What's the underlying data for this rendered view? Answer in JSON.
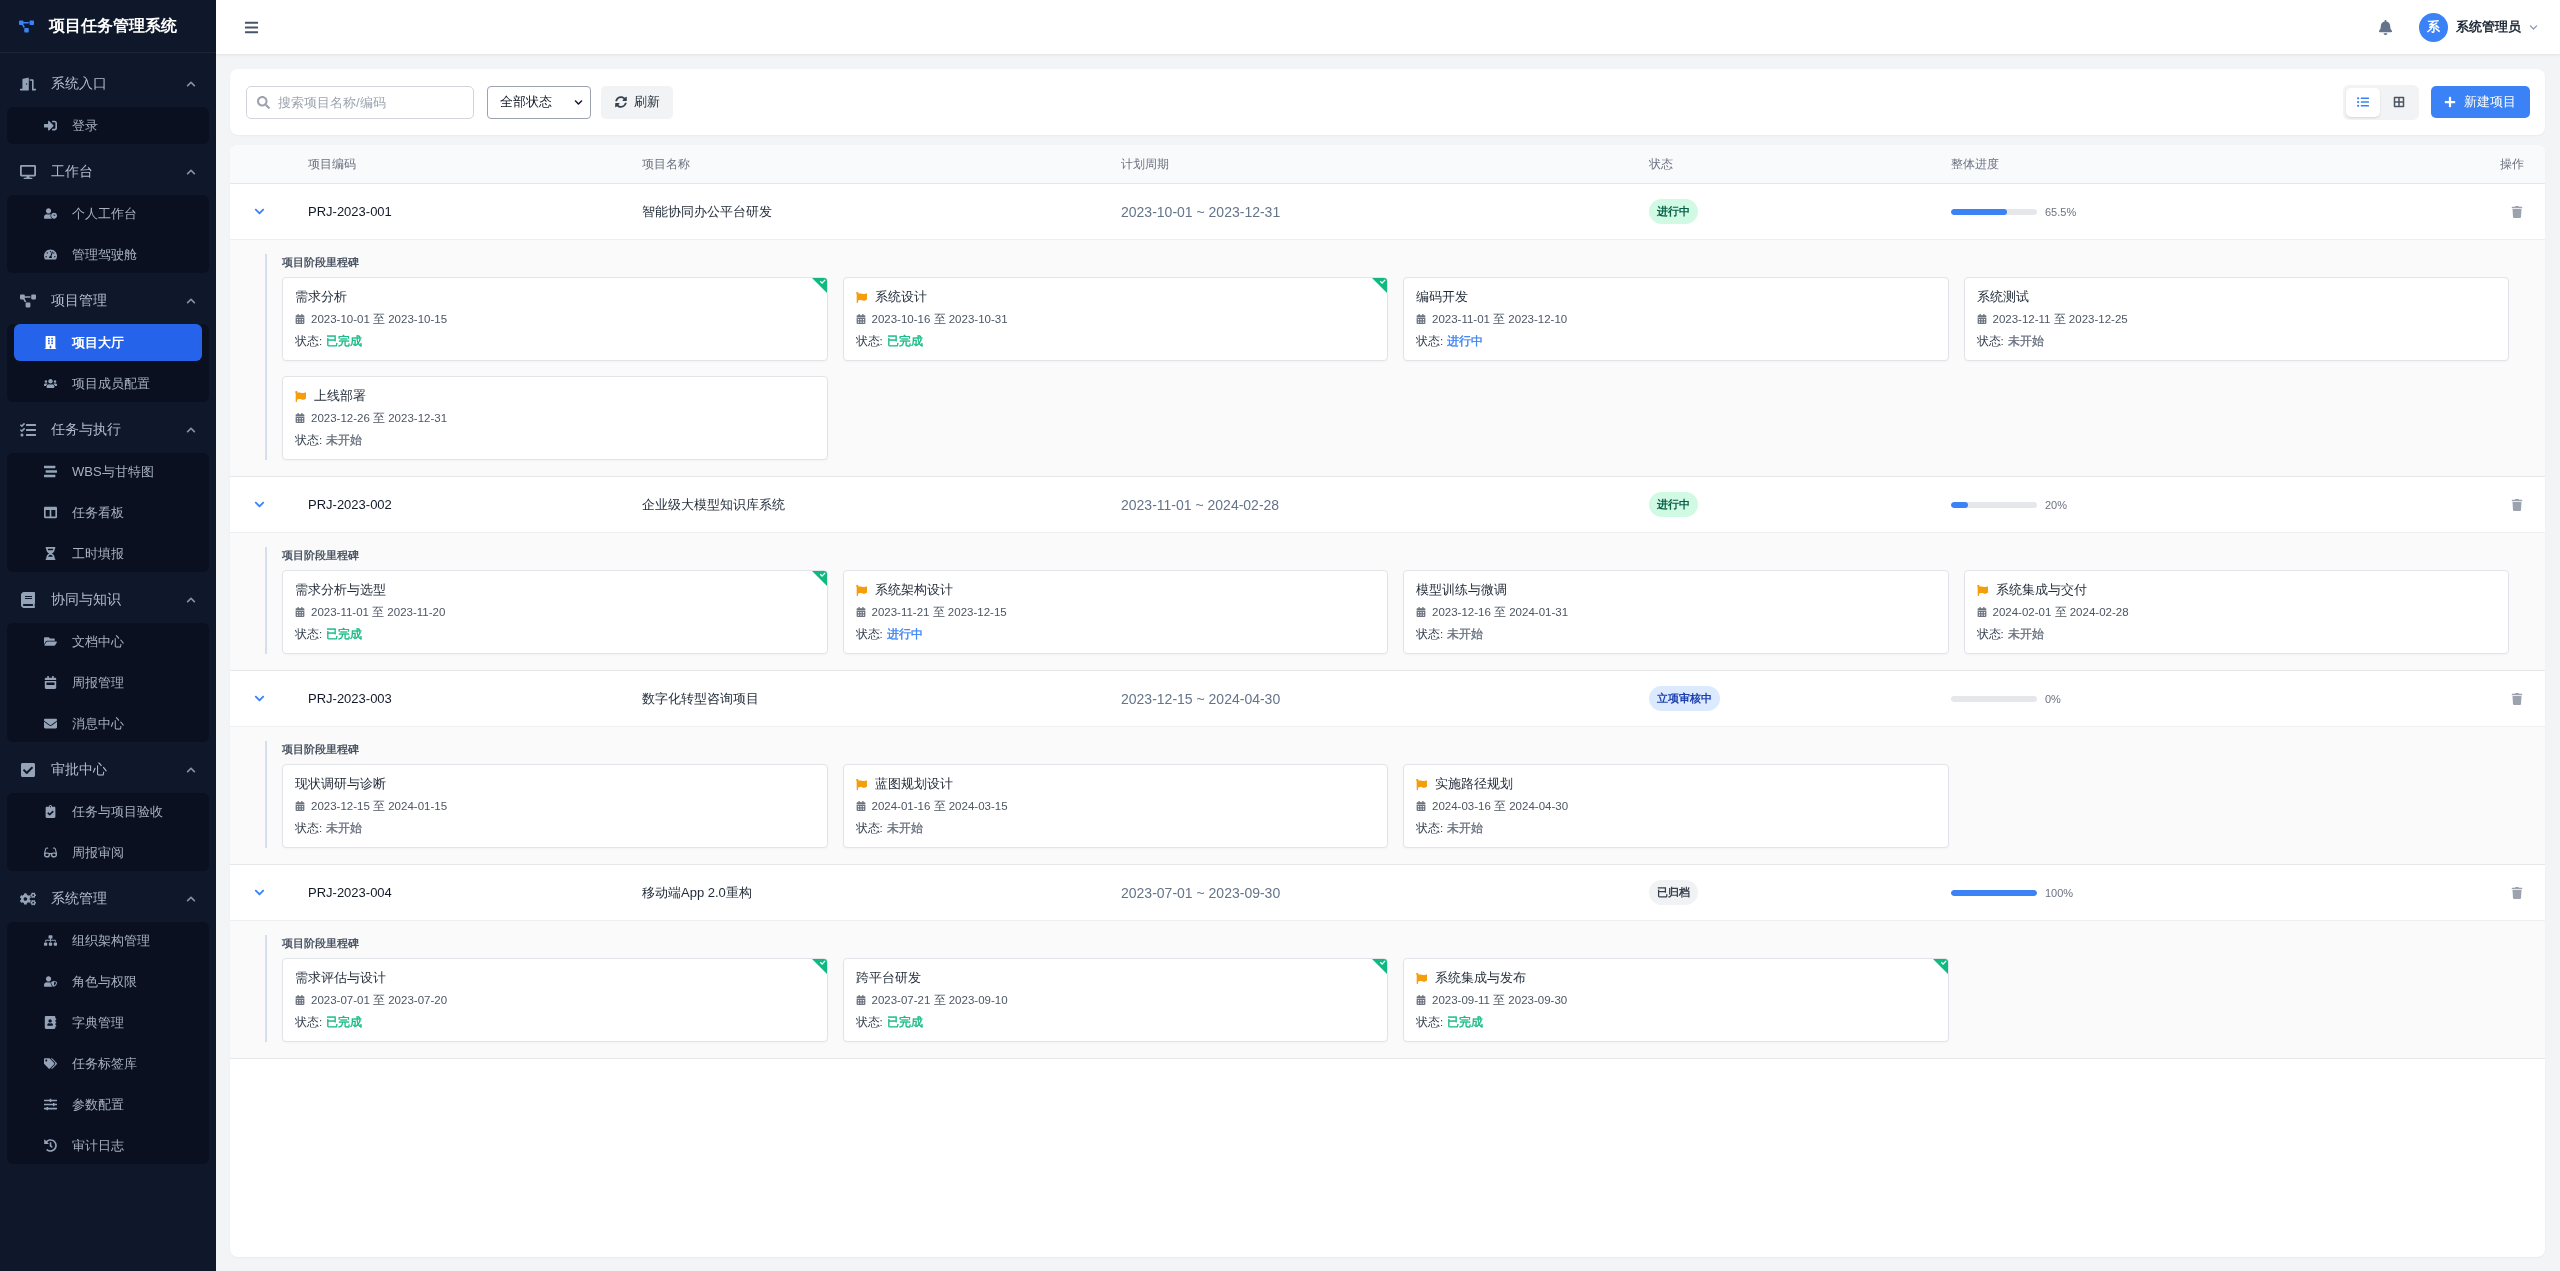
{
  "sidebar": {
    "title": "项目任务管理系统",
    "sections": [
      {
        "label": "系统入口",
        "expanded": true,
        "items": [
          {
            "label": "登录",
            "selected": false
          }
        ]
      },
      {
        "label": "工作台",
        "expanded": true,
        "items": [
          {
            "label": "个人工作台",
            "selected": false
          },
          {
            "label": "管理驾驶舱",
            "selected": false
          }
        ]
      },
      {
        "label": "项目管理",
        "expanded": true,
        "items": [
          {
            "label": "项目大厅",
            "selected": true
          },
          {
            "label": "项目成员配置",
            "selected": false
          }
        ]
      },
      {
        "label": "任务与执行",
        "expanded": true,
        "items": [
          {
            "label": "WBS与甘特图",
            "selected": false
          },
          {
            "label": "任务看板",
            "selected": false
          },
          {
            "label": "工时填报",
            "selected": false
          }
        ]
      },
      {
        "label": "协同与知识",
        "expanded": true,
        "items": [
          {
            "label": "文档中心",
            "selected": false
          },
          {
            "label": "周报管理",
            "selected": false
          },
          {
            "label": "消息中心",
            "selected": false
          }
        ]
      },
      {
        "label": "审批中心",
        "expanded": true,
        "items": [
          {
            "label": "任务与项目验收",
            "selected": false
          },
          {
            "label": "周报审阅",
            "selected": false
          }
        ]
      },
      {
        "label": "系统管理",
        "expanded": true,
        "items": [
          {
            "label": "组织架构管理",
            "selected": false
          },
          {
            "label": "角色与权限",
            "selected": false
          },
          {
            "label": "字典管理",
            "selected": false
          },
          {
            "label": "任务标签库",
            "selected": false
          },
          {
            "label": "参数配置",
            "selected": false
          },
          {
            "label": "审计日志",
            "selected": false
          }
        ]
      }
    ]
  },
  "header": {
    "user": {
      "avatar": "系",
      "name": "系统管理员"
    }
  },
  "toolbar": {
    "search": {
      "placeholder": "搜索项目名称/编码"
    },
    "status_filter": {
      "value": "全部状态"
    },
    "refresh_button": "刷新",
    "view_toggle": [
      {
        "selected": true
      },
      {
        "selected": false
      }
    ],
    "new_button": "新建项目"
  },
  "table": {
    "columns": [
      "项目编码",
      "项目名称",
      "计划周期",
      "状态",
      "整体进度",
      "操作"
    ],
    "projects": [
      {
        "code": "PRJ-2023-001",
        "name": "智能协同办公平台研发",
        "period": "2023-10-01 ~ 2023-12-31",
        "status": "进行中",
        "color": "#d1fae5",
        "level": 0.655,
        "progress": "65.5%",
        "expanded": true,
        "milestones_title": "项目阶段里程碑",
        "milestones": [
          {
            "title": "需求分析",
            "flag": false,
            "dates": "2023-10-01 至 2023-10-15",
            "status_label": "状态:",
            "status": "已完成",
            "color": "#10b981",
            "completed": true
          },
          {
            "title": "系统设计",
            "flag": true,
            "dates": "2023-10-16 至 2023-10-31",
            "status_label": "状态:",
            "status": "已完成",
            "color": "#10b981",
            "completed": true
          },
          {
            "title": "编码开发",
            "flag": false,
            "dates": "2023-11-01 至 2023-12-10",
            "status_label": "状态:",
            "status": "进行中",
            "color": "#3b82f6",
            "completed": false
          },
          {
            "title": "系统测试",
            "flag": false,
            "dates": "2023-12-11 至 2023-12-25",
            "status_label": "状态:",
            "status": "未开始",
            "color": "#6b7280",
            "completed": false
          },
          {
            "title": "上线部署",
            "flag": true,
            "dates": "2023-12-26 至 2023-12-31",
            "status_label": "状态:",
            "status": "未开始",
            "color": "#6b7280",
            "completed": false
          }
        ]
      },
      {
        "code": "PRJ-2023-002",
        "name": "企业级大模型知识库系统",
        "period": "2023-11-01 ~ 2024-02-28",
        "status": "进行中",
        "color": "#d1fae5",
        "level": 0.2,
        "progress": "20%",
        "expanded": true,
        "milestones_title": "项目阶段里程碑",
        "milestones": [
          {
            "title": "需求分析与选型",
            "flag": false,
            "dates": "2023-11-01 至 2023-11-20",
            "status_label": "状态:",
            "status": "已完成",
            "color": "#10b981",
            "completed": true
          },
          {
            "title": "系统架构设计",
            "flag": true,
            "dates": "2023-11-21 至 2023-12-15",
            "status_label": "状态:",
            "status": "进行中",
            "color": "#3b82f6",
            "completed": false
          },
          {
            "title": "模型训练与微调",
            "flag": false,
            "dates": "2023-12-16 至 2024-01-31",
            "status_label": "状态:",
            "status": "未开始",
            "color": "#6b7280",
            "completed": false
          },
          {
            "title": "系统集成与交付",
            "flag": true,
            "dates": "2024-02-01 至 2024-02-28",
            "status_label": "状态:",
            "status": "未开始",
            "color": "#6b7280",
            "completed": false
          }
        ]
      },
      {
        "code": "PRJ-2023-003",
        "name": "数字化转型咨询项目",
        "period": "2023-12-15 ~ 2024-04-30",
        "status": "立项审核中",
        "color": "#dbeafe",
        "level": 0,
        "progress": "0%",
        "expanded": true,
        "milestones_title": "项目阶段里程碑",
        "milestones": [
          {
            "title": "现状调研与诊断",
            "flag": false,
            "dates": "2023-12-15 至 2024-01-15",
            "status_label": "状态:",
            "status": "未开始",
            "color": "#6b7280",
            "completed": false
          },
          {
            "title": "蓝图规划设计",
            "flag": true,
            "dates": "2024-01-16 至 2024-03-15",
            "status_label": "状态:",
            "status": "未开始",
            "color": "#6b7280",
            "completed": false
          },
          {
            "title": "实施路径规划",
            "flag": true,
            "dates": "2024-03-16 至 2024-04-30",
            "status_label": "状态:",
            "status": "未开始",
            "color": "#6b7280",
            "completed": false
          }
        ]
      },
      {
        "code": "PRJ-2023-004",
        "name": "移动端App 2.0重构",
        "period": "2023-07-01 ~ 2023-09-30",
        "status": "已归档",
        "color": "#f1f2f4",
        "level": 1,
        "progress": "100%",
        "expanded": true,
        "milestones_title": "项目阶段里程碑",
        "milestones": [
          {
            "title": "需求评估与设计",
            "flag": false,
            "dates": "2023-07-01 至 2023-07-20",
            "status_label": "状态:",
            "status": "已完成",
            "color": "#10b981",
            "completed": true
          },
          {
            "title": "跨平台研发",
            "flag": false,
            "dates": "2023-07-21 至 2023-09-10",
            "status_label": "状态:",
            "status": "已完成",
            "color": "#10b981",
            "completed": true
          },
          {
            "title": "系统集成与发布",
            "flag": true,
            "dates": "2023-09-11 至 2023-09-30",
            "status_label": "状态:",
            "status": "已完成",
            "color": "#10b981",
            "completed": true
          }
        ]
      }
    ]
  }
}
